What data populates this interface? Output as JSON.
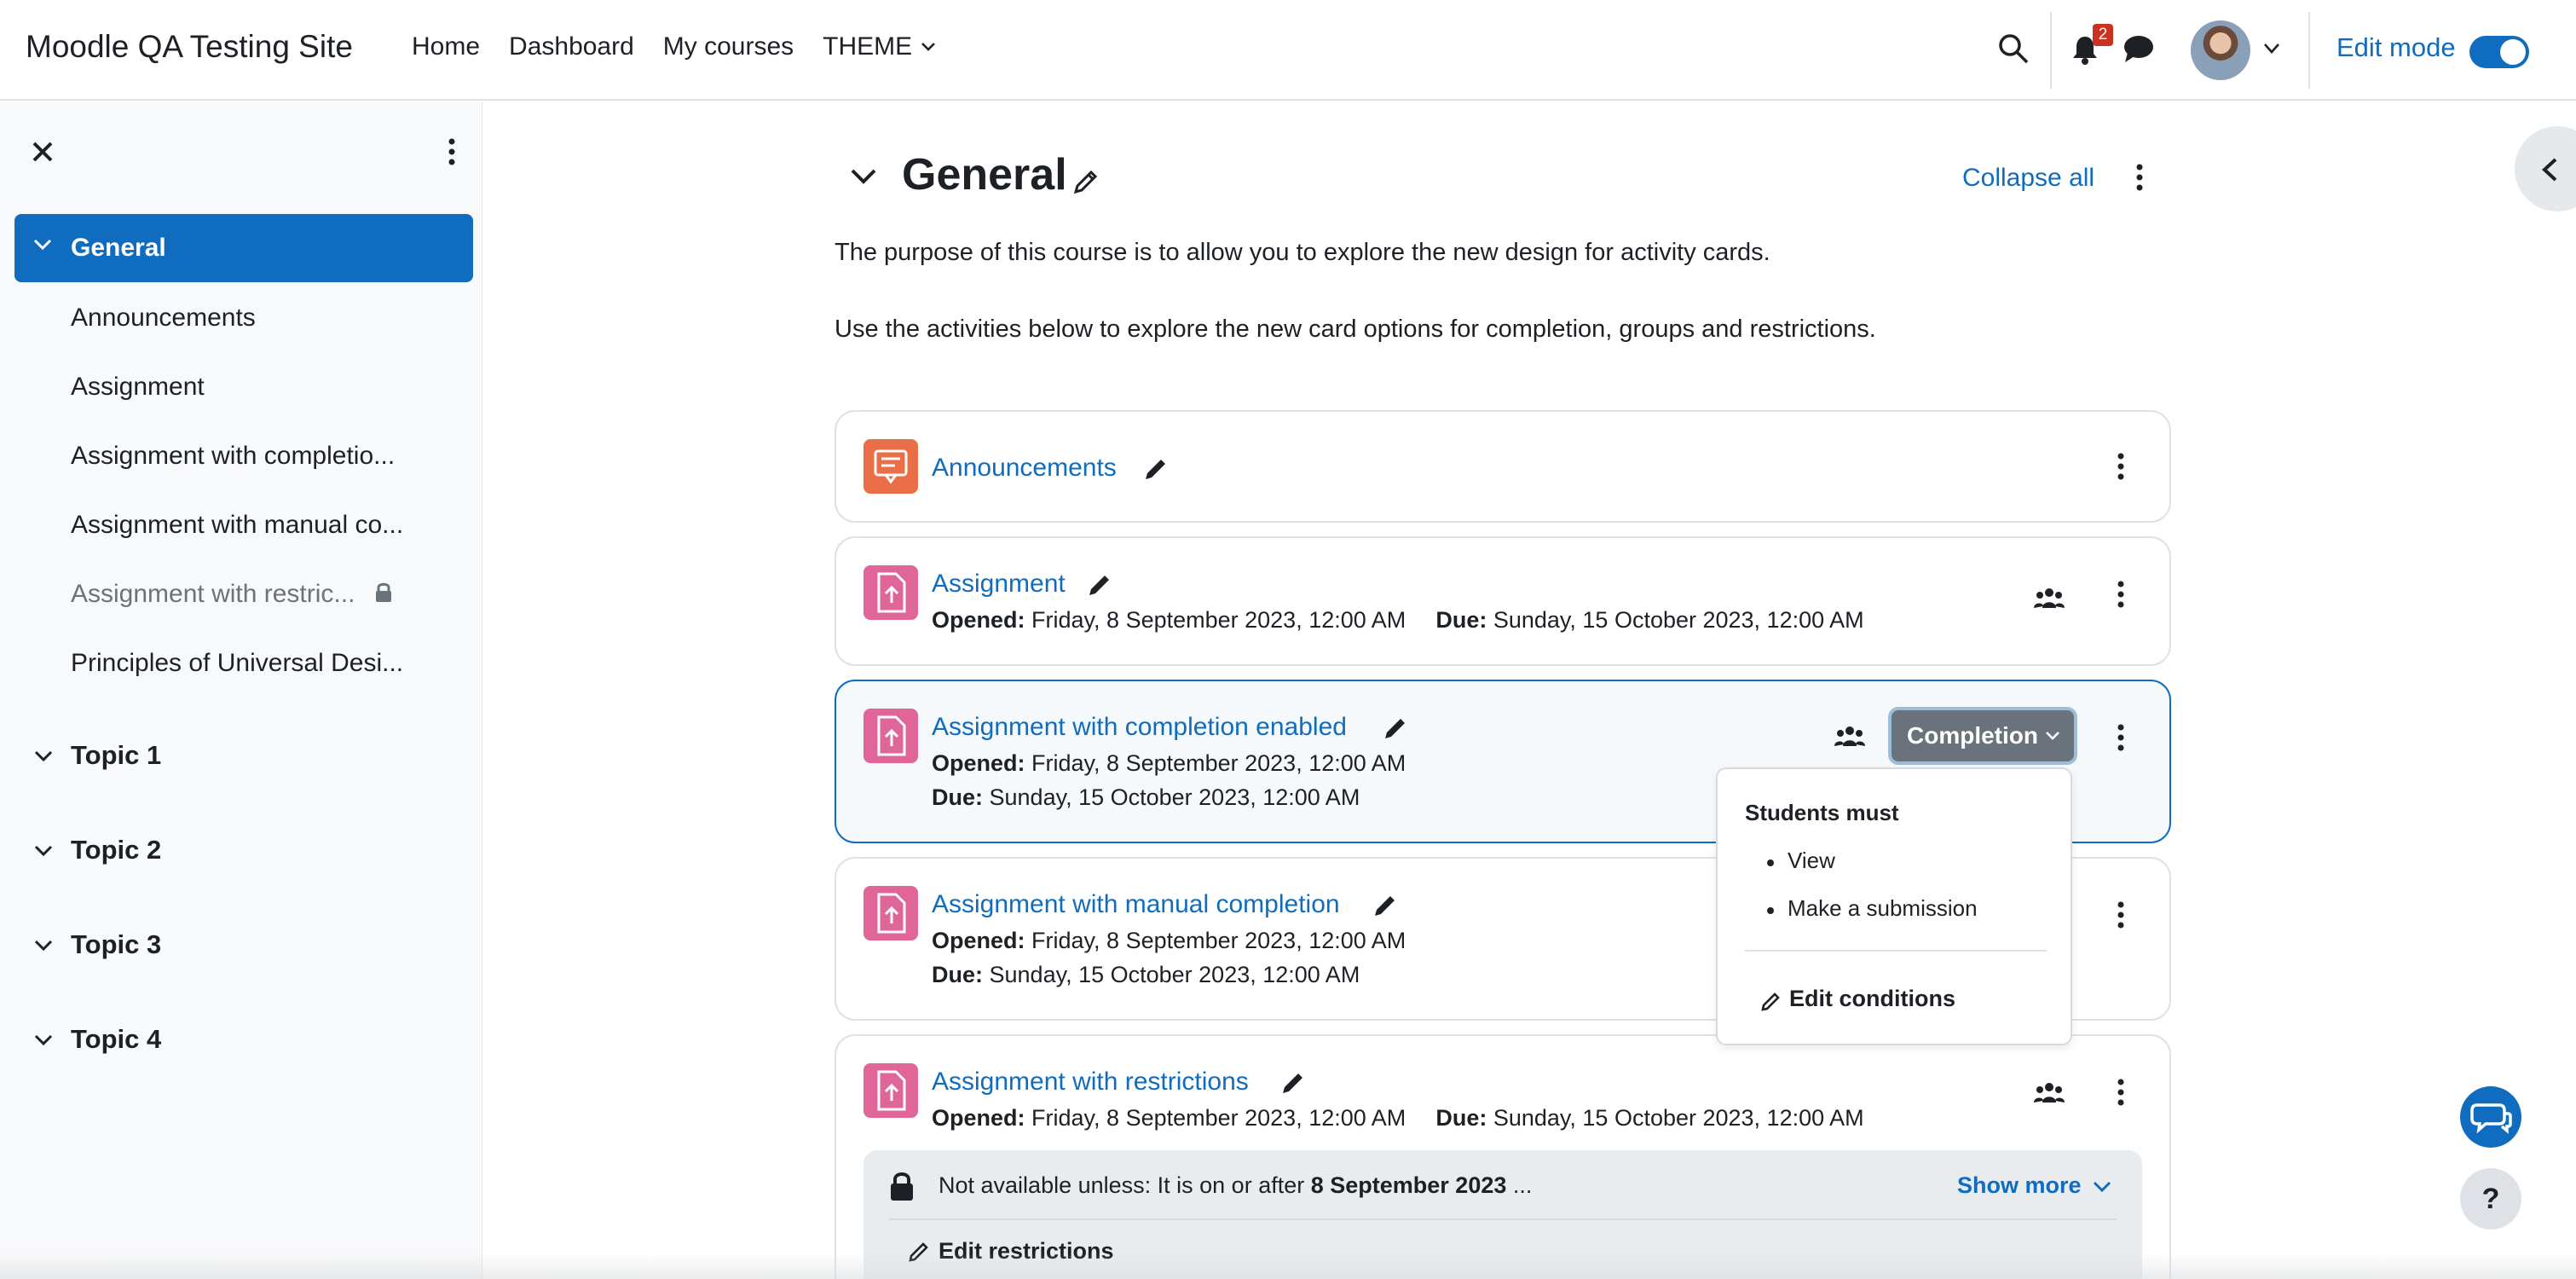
{
  "navbar": {
    "brand": "Moodle QA Testing Site",
    "links": [
      "Home",
      "Dashboard",
      "My courses",
      "THEME"
    ],
    "notification_count": "2",
    "edit_mode_label": "Edit mode",
    "edit_mode_on": true
  },
  "drawer": {
    "active_section": "General",
    "general_items": [
      "Announcements",
      "Assignment",
      "Assignment with completio...",
      "Assignment with manual co...",
      "Assignment with restric...",
      "Principles of Universal Desi..."
    ],
    "topics": [
      "Topic 1",
      "Topic 2",
      "Topic 3",
      "Topic 4"
    ]
  },
  "section": {
    "title": "General",
    "collapse_all": "Collapse all",
    "summary_1": "The purpose of this course is to allow you to explore the new design for activity cards.",
    "summary_2": "Use the activities below to explore the new card options for completion, groups and restrictions."
  },
  "activities": [
    {
      "name": "Announcements"
    },
    {
      "name": "Assignment",
      "opened_label": "Opened:",
      "opened": "Friday, 8 September 2023, 12:00 AM",
      "due_label": "Due:",
      "due": "Sunday, 15 October 2023, 12:00 AM"
    },
    {
      "name": "Assignment with completion enabled",
      "opened_label": "Opened:",
      "opened": "Friday, 8 September 2023, 12:00 AM",
      "due_label": "Due:",
      "due": "Sunday, 15 October 2023, 12:00 AM",
      "completion_label": "Completion"
    },
    {
      "name": "Assignment with manual completion",
      "opened_label": "Opened:",
      "opened": "Friday, 8 September 2023, 12:00 AM",
      "due_label": "Due:",
      "due": "Sunday, 15 October 2023, 12:00 AM"
    },
    {
      "name": "Assignment with restrictions",
      "opened_label": "Opened:",
      "opened": "Friday, 8 September 2023, 12:00 AM",
      "due_label": "Due:",
      "due": "Sunday, 15 October 2023, 12:00 AM",
      "restriction_prefix": "Not available unless: It is on or after",
      "restriction_date": "8 September 2023",
      "restriction_suffix": "...",
      "show_more": "Show more",
      "edit_restrictions": "Edit restrictions"
    }
  ],
  "completion_dropdown": {
    "title": "Students must",
    "items": [
      "View",
      "Make a submission"
    ],
    "edit_conditions": "Edit conditions"
  },
  "help_label": "?",
  "colors": {
    "primary": "#0f6cbf",
    "forum_icon": "#ea6e47",
    "assign_icon": "#e0669a",
    "badge": "#ca3120"
  }
}
